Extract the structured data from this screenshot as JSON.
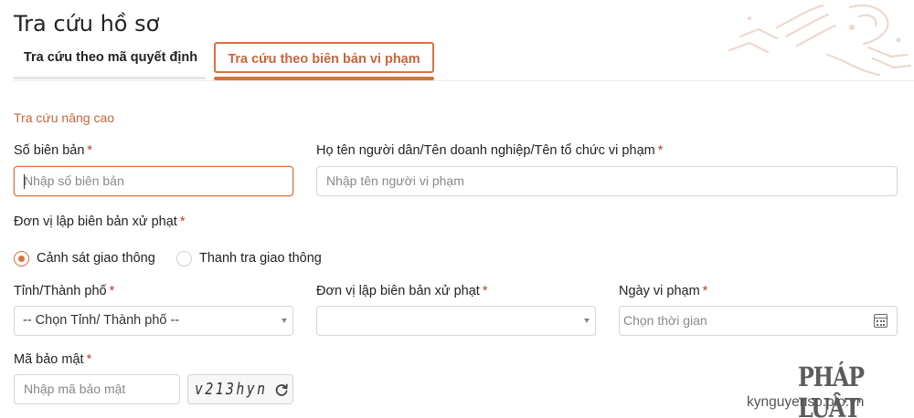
{
  "page": {
    "title": "Tra cứu hồ sơ"
  },
  "tabs": [
    {
      "label": "Tra cứu theo mã quyết định",
      "active": false
    },
    {
      "label": "Tra cứu theo biên bản vi phạm",
      "active": true
    }
  ],
  "section": {
    "title": "Tra cứu nâng cao"
  },
  "required_mark": "*",
  "fields": {
    "record_number": {
      "label": "Số biên bản",
      "placeholder": "Nhập số biên bản",
      "value": ""
    },
    "violator_name": {
      "label": "Họ tên người dân/Tên doanh nghiệp/Tên tổ chức vi phạm",
      "placeholder": "Nhập tên người vi phạm",
      "value": ""
    },
    "issuing_unit_type": {
      "label": "Đơn vị lập biên bản xử phạt",
      "options": [
        {
          "label": "Cảnh sát giao thông",
          "checked": true
        },
        {
          "label": "Thanh tra giao thông",
          "checked": false
        }
      ]
    },
    "province": {
      "label": "Tỉnh/Thành phố",
      "selected": "-- Chọn Tỉnh/ Thành phố --"
    },
    "issuing_unit": {
      "label": "Đơn vị lập biên bản xử phạt",
      "selected": ""
    },
    "violation_date": {
      "label": "Ngày vi phạm",
      "placeholder": "Chọn thời gian",
      "icon": "calendar-icon"
    },
    "security_code": {
      "label": "Mã bảo mật",
      "placeholder": "Nhập mã bảo mật",
      "captcha": "v213hyn",
      "refresh_icon": "refresh-icon"
    }
  },
  "watermark": {
    "logo": "PHÁP LUẬT",
    "url": "kynguyenso.plo.vn"
  },
  "colors": {
    "accent": "#d9713f",
    "accent_text": "#c8643c",
    "required": "#c0392b",
    "border": "#d4d4d4"
  }
}
